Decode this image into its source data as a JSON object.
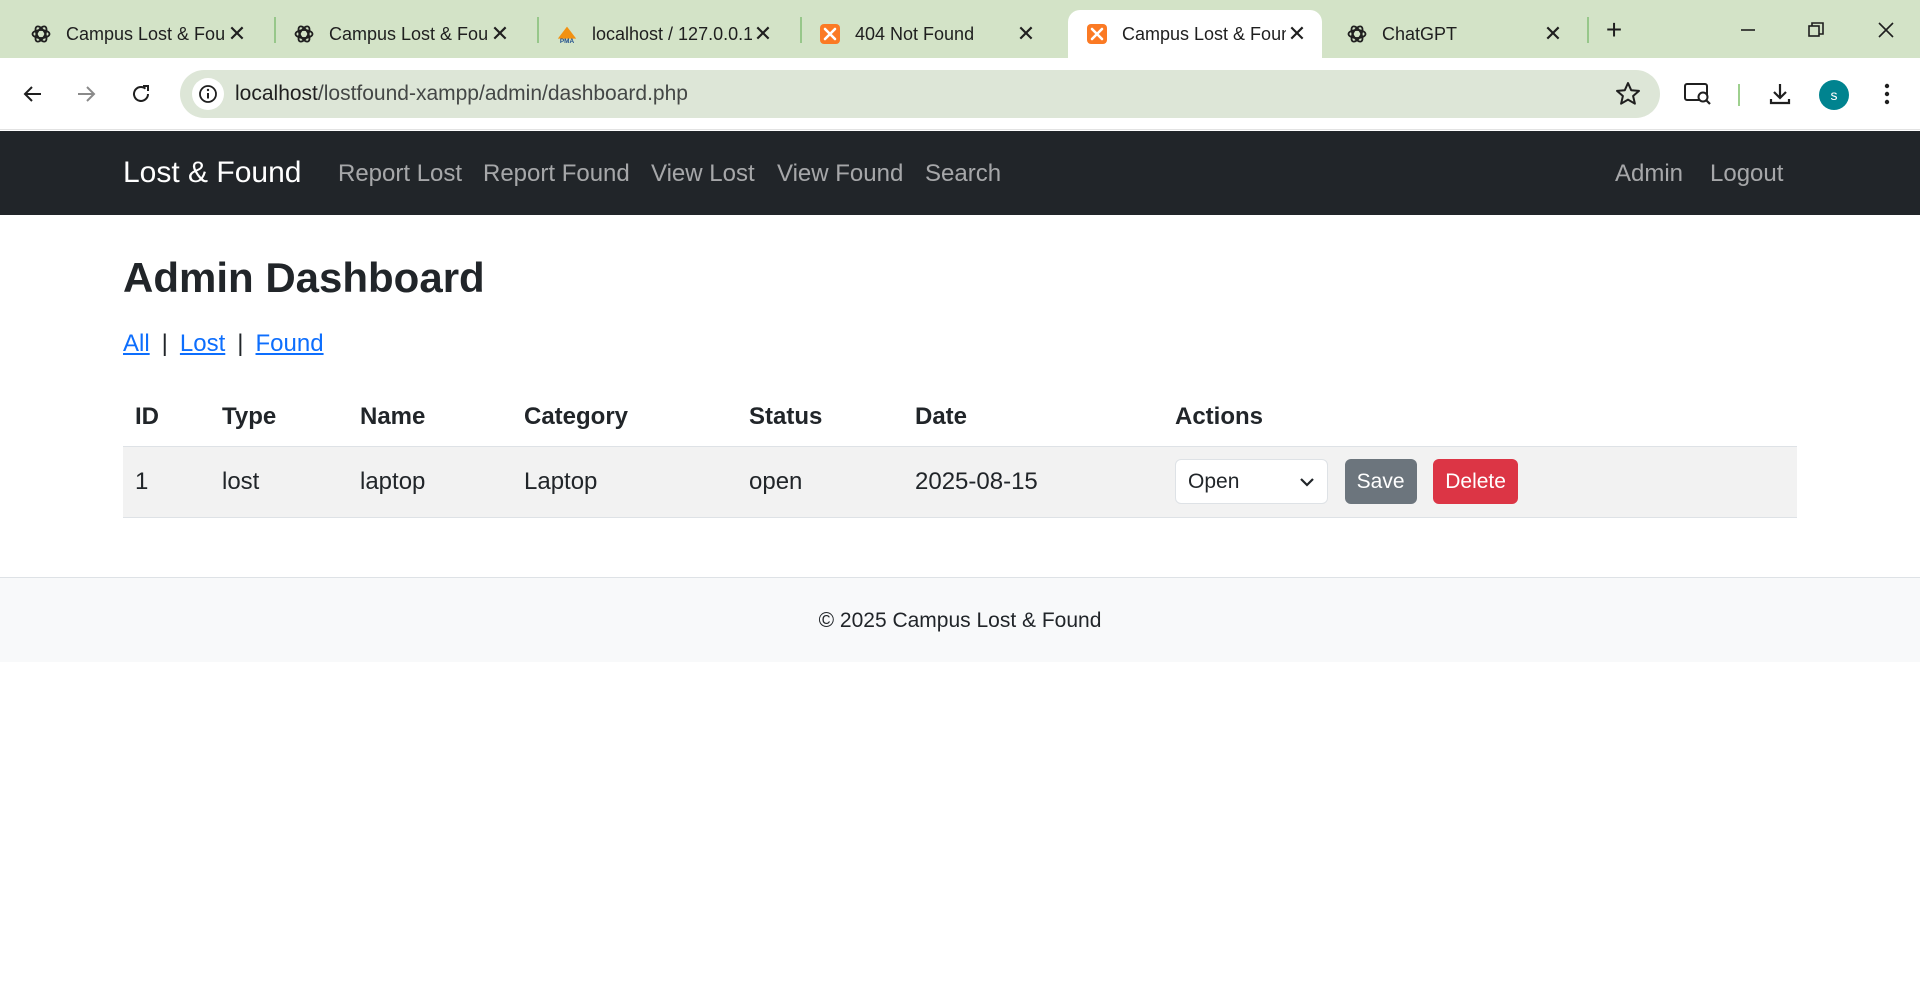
{
  "browser": {
    "tabs": [
      {
        "title": "Campus Lost & Found",
        "icon": "chatgpt-icon",
        "active": false
      },
      {
        "title": "Campus Lost & Found",
        "icon": "chatgpt-icon",
        "active": false
      },
      {
        "title": "localhost / 127.0.0.1",
        "icon": "phpmyadmin-icon",
        "active": false
      },
      {
        "title": "404 Not Found",
        "icon": "xampp-icon",
        "active": false
      },
      {
        "title": "Campus Lost & Found",
        "icon": "xampp-icon",
        "active": true
      },
      {
        "title": "ChatGPT",
        "icon": "chatgpt-icon",
        "active": false
      }
    ],
    "url_host": "localhost",
    "url_path": "/lostfound-xampp/admin/dashboard.php",
    "profile_initial": "s",
    "colors": {
      "tabstrip": "#d3e3c7",
      "omnibox": "#dde6d7",
      "avatar": "#00838f"
    }
  },
  "site": {
    "brand": "Lost & Found",
    "nav": {
      "report_lost": "Report Lost",
      "report_found": "Report Found",
      "view_lost": "View Lost",
      "view_found": "View Found",
      "search": "Search",
      "admin": "Admin",
      "logout": "Logout"
    },
    "colors": {
      "navbar": "#212529",
      "link": "#0d6efd",
      "save": "#6c757d",
      "delete": "#dc3545"
    }
  },
  "main": {
    "title": "Admin Dashboard",
    "filters": {
      "all": "All",
      "lost": "Lost",
      "found": "Found",
      "separator": "|"
    },
    "table": {
      "headers": {
        "id": "ID",
        "type": "Type",
        "name": "Name",
        "category": "Category",
        "status": "Status",
        "date": "Date",
        "actions": "Actions"
      },
      "rows": [
        {
          "id": "1",
          "type": "lost",
          "name": "laptop",
          "category": "Laptop",
          "status": "open",
          "date": "2025-08-15",
          "status_select": "Open",
          "save_label": "Save",
          "delete_label": "Delete"
        }
      ]
    }
  },
  "footer": {
    "text": "© 2025 Campus Lost & Found"
  }
}
